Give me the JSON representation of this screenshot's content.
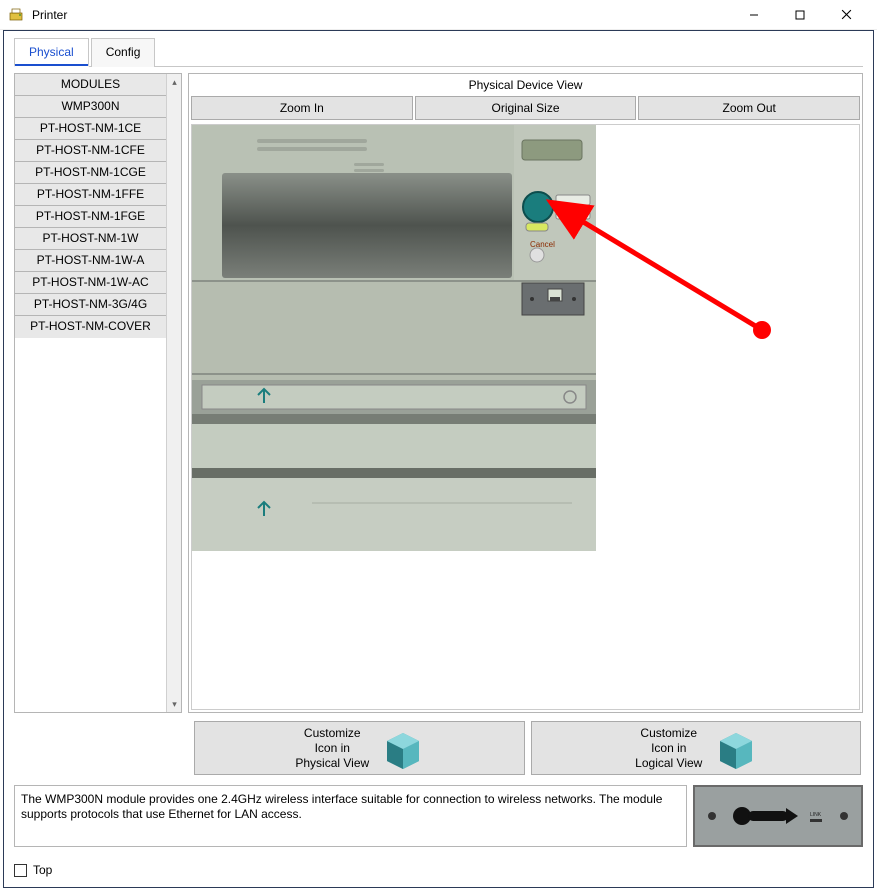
{
  "window": {
    "title": "Printer"
  },
  "tabs": {
    "physical": "Physical",
    "config": "Config"
  },
  "modules": {
    "items": [
      "MODULES",
      "WMP300N",
      "PT-HOST-NM-1CE",
      "PT-HOST-NM-1CFE",
      "PT-HOST-NM-1CGE",
      "PT-HOST-NM-1FFE",
      "PT-HOST-NM-1FGE",
      "PT-HOST-NM-1W",
      "PT-HOST-NM-1W-A",
      "PT-HOST-NM-1W-AC",
      "PT-HOST-NM-3G/4G",
      "PT-HOST-NM-COVER"
    ]
  },
  "device_view": {
    "header": "Physical Device View",
    "zoom_in": "Zoom In",
    "original_size": "Original Size",
    "zoom_out": "Zoom Out",
    "cancel_label": "Cancel"
  },
  "customize": {
    "physical": "Customize\nIcon in\nPhysical View",
    "logical": "Customize\nIcon in\nLogical View"
  },
  "description": "The WMP300N module provides one 2.4GHz wireless interface suitable for connection to wireless networks. The module supports protocols that use Ethernet for LAN access.",
  "footer": {
    "top": "Top"
  }
}
